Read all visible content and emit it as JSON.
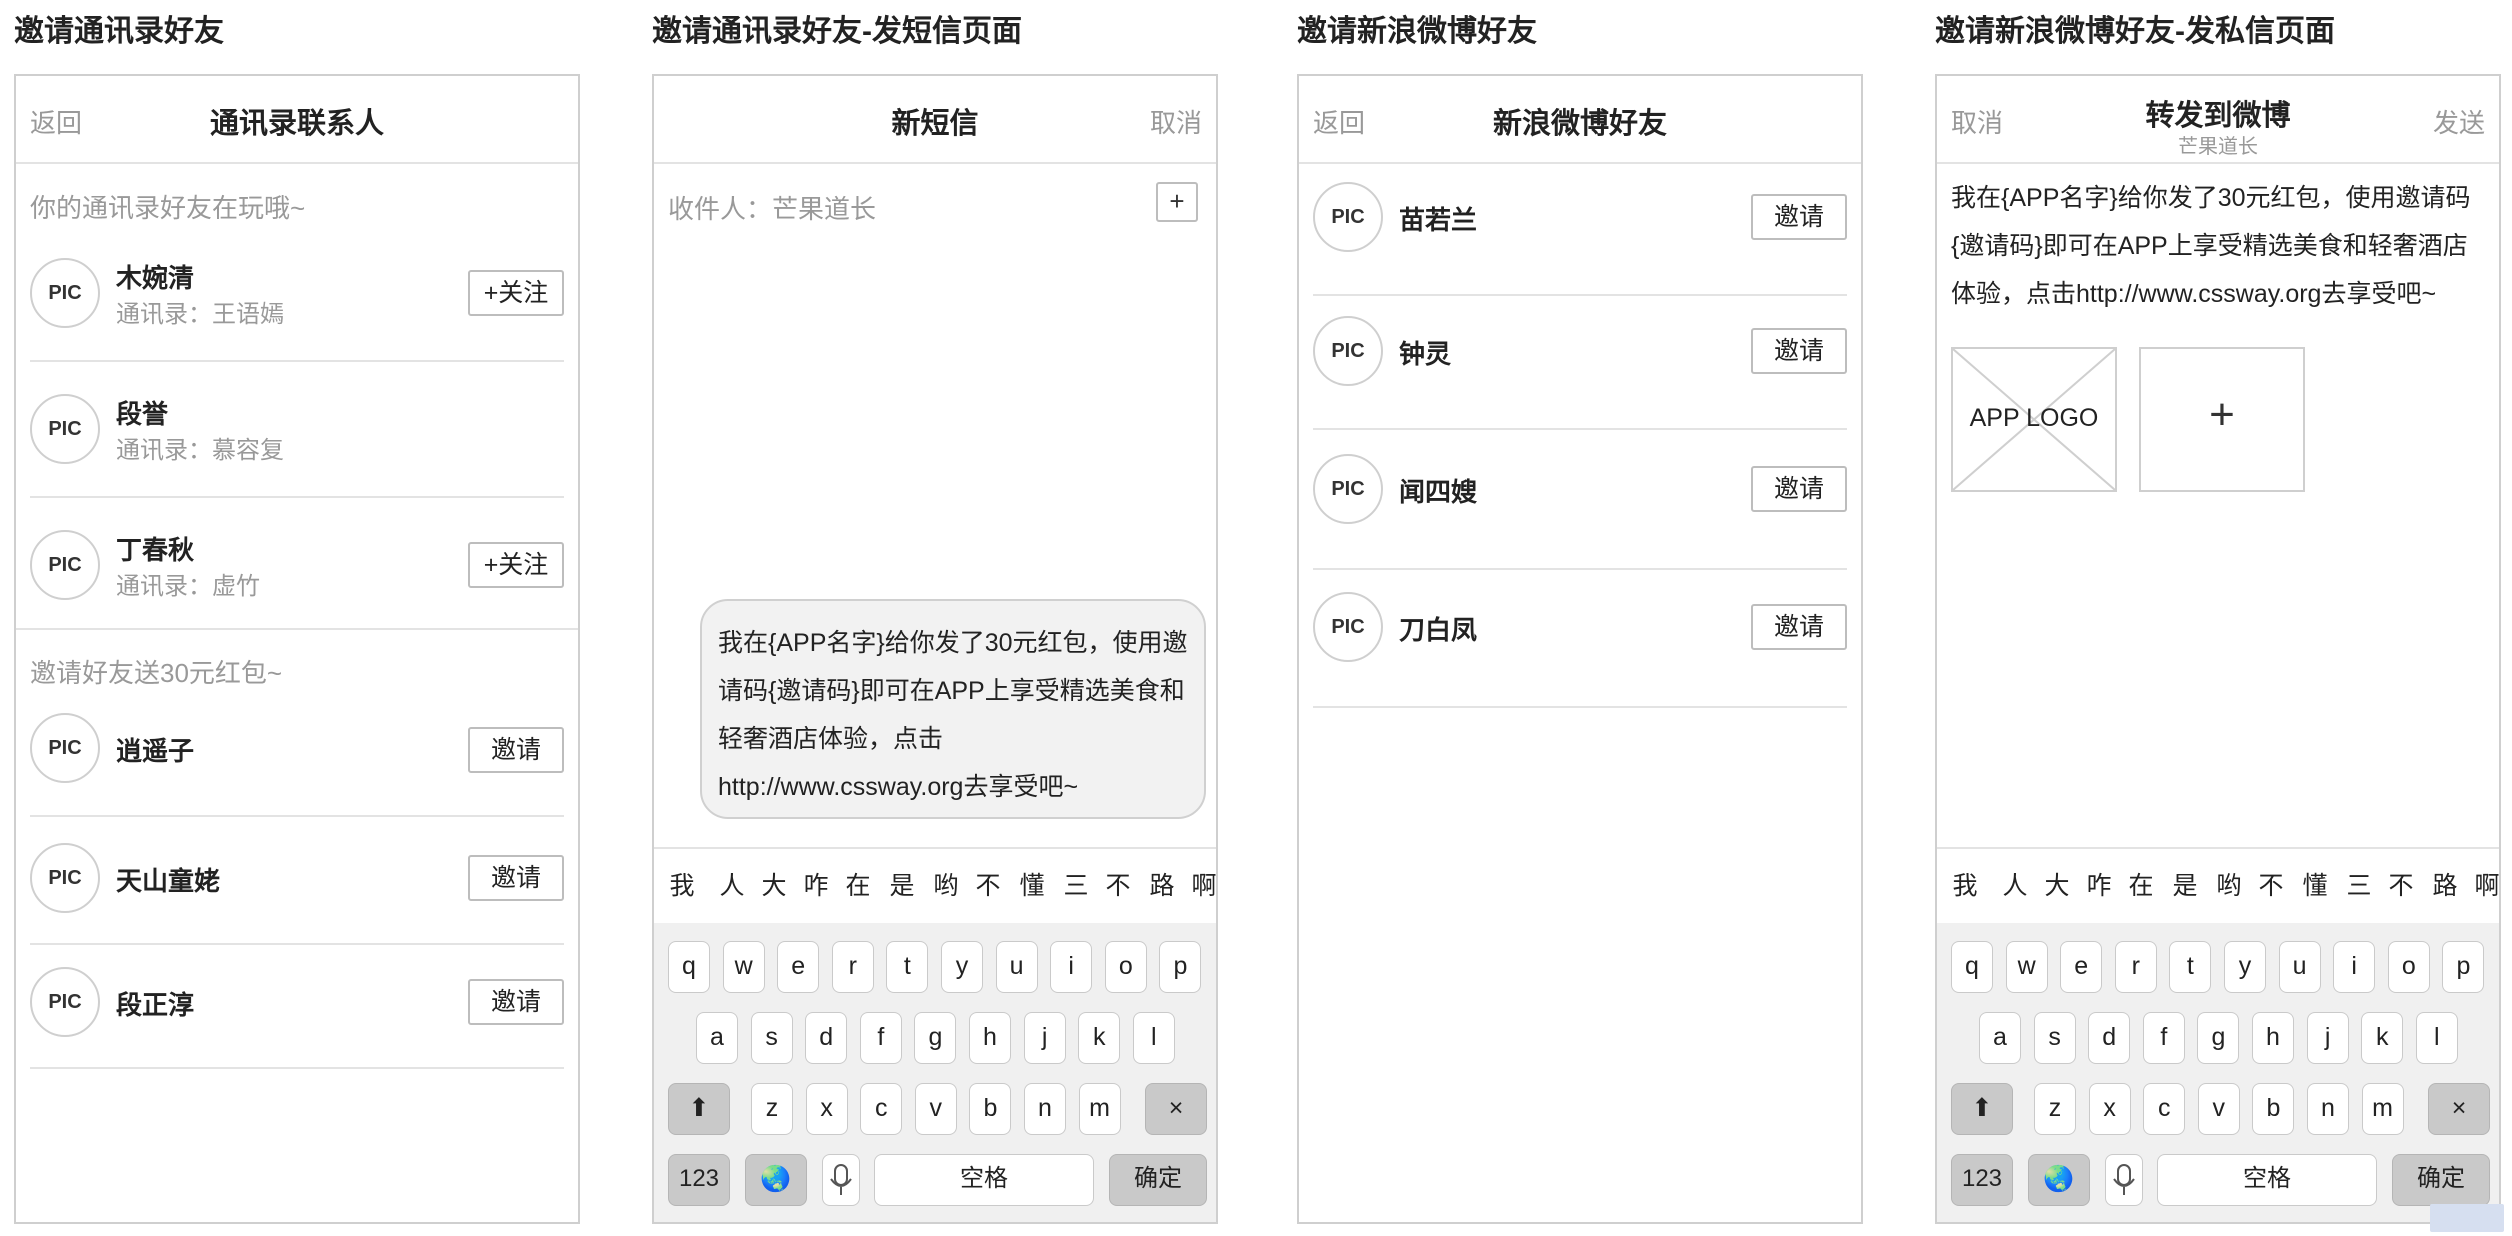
{
  "section_titles": [
    "邀请通讯录好友",
    "邀请通讯录好友-发短信页面",
    "邀请新浪微博好友",
    "邀请新浪微博好友-发私信页面"
  ],
  "contacts_screen": {
    "back": "返回",
    "title": "通讯录联系人",
    "section1_label": "你的通讯录好友在玩哦~",
    "section1_items": [
      {
        "avatar": "PIC",
        "name": "木婉清",
        "sub": "通讯录：王语嫣",
        "action": "+关注"
      },
      {
        "avatar": "PIC",
        "name": "段誉",
        "sub": "通讯录：慕容复",
        "action": ""
      },
      {
        "avatar": "PIC",
        "name": "丁春秋",
        "sub": "通讯录：虚竹",
        "action": "+关注"
      }
    ],
    "section2_label": "邀请好友送30元红包~",
    "section2_items": [
      {
        "avatar": "PIC",
        "name": "逍遥子",
        "action": "邀请"
      },
      {
        "avatar": "PIC",
        "name": "天山童姥",
        "action": "邀请"
      },
      {
        "avatar": "PIC",
        "name": "段正淳",
        "action": "邀请"
      }
    ]
  },
  "sms_screen": {
    "title": "新短信",
    "cancel": "取消",
    "recipient": "收件人：芒果道长",
    "add": "+",
    "message": "我在{APP名字}给你发了30元红包，使用邀请码{邀请码}即可在APP上享受精选美食和轻奢酒店体验，点击http://www.cssway.org去享受吧~"
  },
  "weibo_screen": {
    "back": "返回",
    "title": "新浪微博好友",
    "items": [
      {
        "avatar": "PIC",
        "name": "苗若兰",
        "action": "邀请"
      },
      {
        "avatar": "PIC",
        "name": "钟灵",
        "action": "邀请"
      },
      {
        "avatar": "PIC",
        "name": "闻四嫂",
        "action": "邀请"
      },
      {
        "avatar": "PIC",
        "name": "刀白凤",
        "action": "邀请"
      }
    ]
  },
  "weibo_post_screen": {
    "cancel": "取消",
    "title": "转发到微博",
    "subtitle": "芒果道长",
    "send": "发送",
    "message": "我在{APP名字}给你发了30元红包，使用邀请码{邀请码}即可在APP上享受精选美食和轻奢酒店体验，点击http://www.cssway.org去享受吧~",
    "logo_label": "APP LOGO",
    "add": "+"
  },
  "keyboard": {
    "suggestions": [
      "我",
      "人",
      "大",
      "咋",
      "在",
      "是",
      "哟",
      "不",
      "懂",
      "三",
      "不",
      "路",
      "啊"
    ],
    "row1": [
      "q",
      "w",
      "e",
      "r",
      "t",
      "y",
      "u",
      "i",
      "o",
      "p"
    ],
    "row2": [
      "a",
      "s",
      "d",
      "f",
      "g",
      "h",
      "j",
      "k",
      "l"
    ],
    "row3": [
      "z",
      "x",
      "c",
      "v",
      "b",
      "n",
      "m"
    ],
    "shift": "⬆",
    "delete": "×",
    "num": "123",
    "globe": "🌏",
    "space": "空格",
    "confirm": "确定"
  },
  "icons": {
    "shift": "shift-icon",
    "delete": "delete-icon",
    "globe": "globe-icon",
    "mic": "microphone-icon"
  }
}
